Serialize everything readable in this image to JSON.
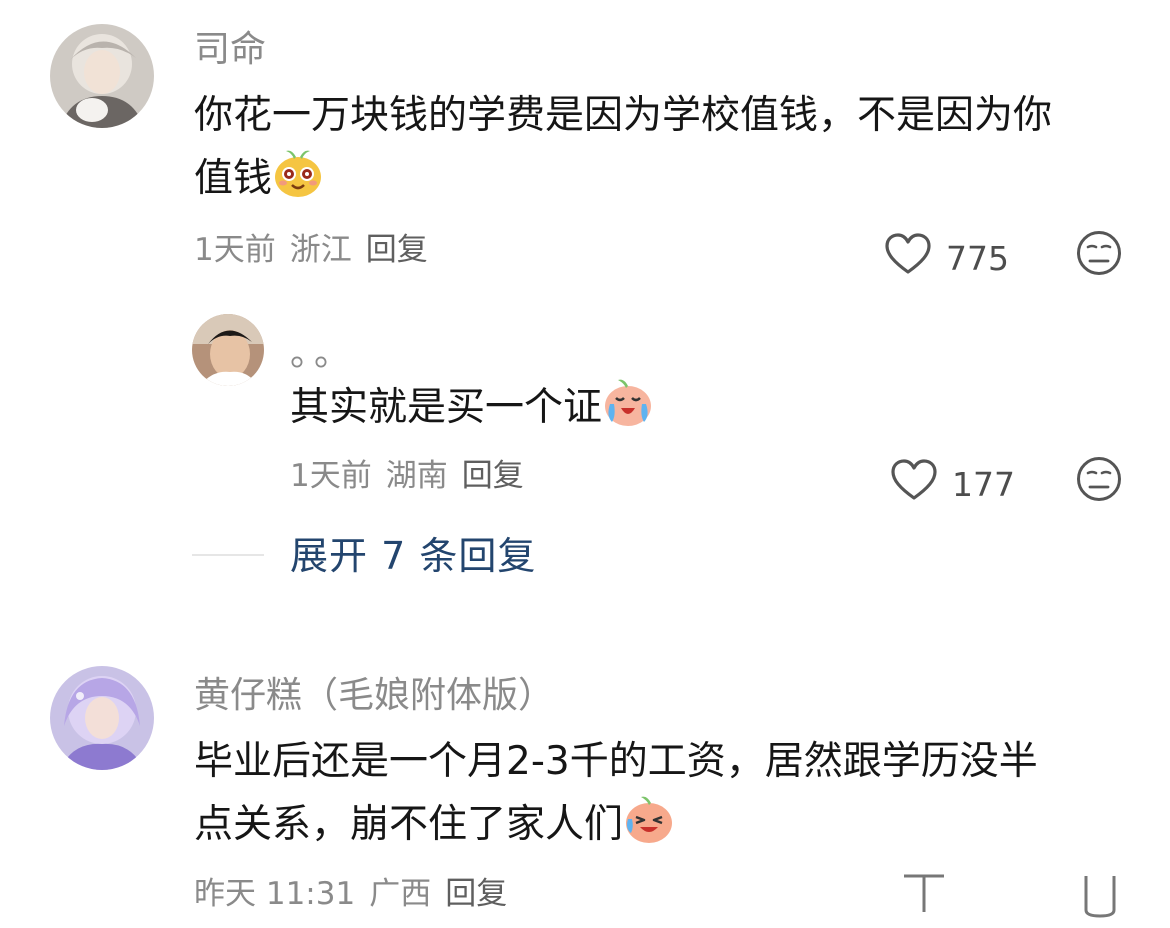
{
  "comments": [
    {
      "username": "司命",
      "text_lines": [
        "你花一万块钱的学费是因为学校值钱，不是因为你",
        "值钱"
      ],
      "emoji": "smug-face-emoji",
      "time": "1天前",
      "location": "浙江",
      "reply_label": "回复",
      "likes": "775",
      "reply": {
        "username": "。。",
        "text": "其实就是买一个证",
        "emoji": "crying-face-emoji",
        "time": "1天前",
        "location": "湖南",
        "reply_label": "回复",
        "likes": "177"
      },
      "expand_label": "展开 7 条回复"
    },
    {
      "username": "黄仔糕（毛娘附体版）",
      "text_lines": [
        "毕业后还是一个月2-3千的工资，居然跟学历没半",
        "点关系，崩不住了家人们"
      ],
      "emoji": "laughing-crying-emoji",
      "time": "昨天 11:31",
      "location": "广西",
      "reply_label": "回复"
    }
  ],
  "icons": {
    "like": "heart-outline-icon",
    "dislike": "unamused-face-icon"
  },
  "colors": {
    "username": "#8a8a8a",
    "expand_link": "#23456e",
    "meta": "#8a8a8a"
  }
}
